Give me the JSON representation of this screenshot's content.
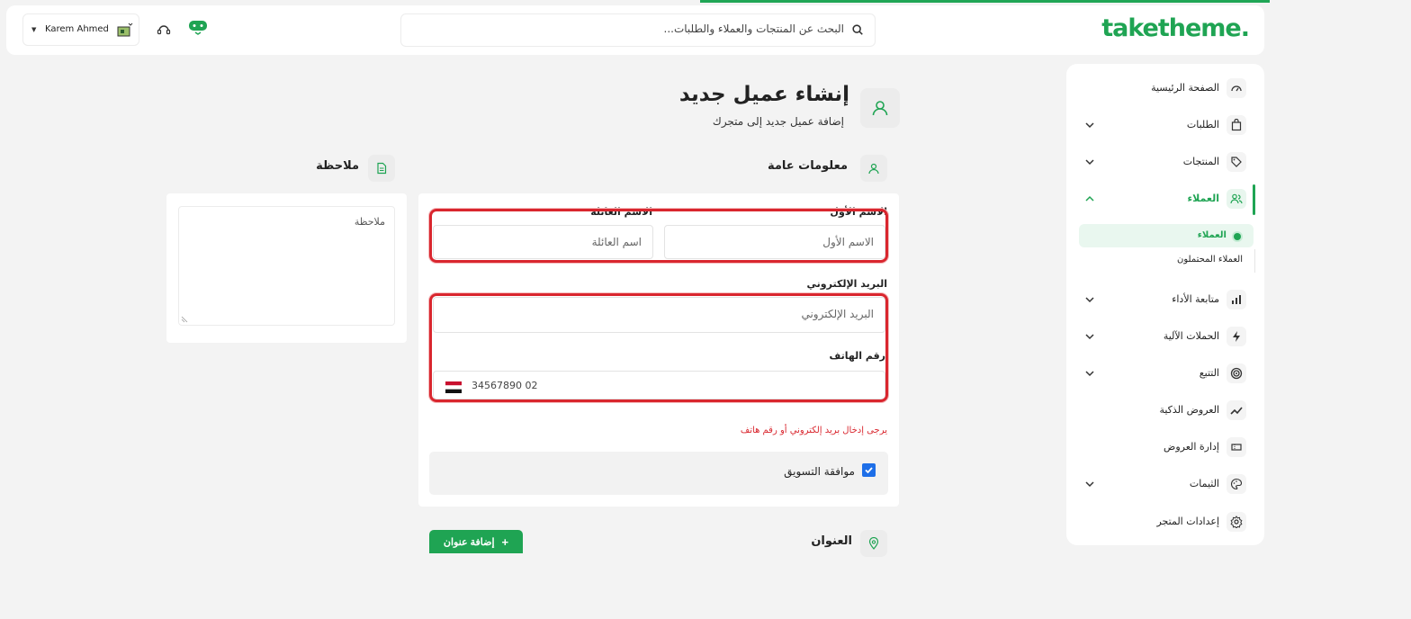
{
  "header": {
    "logo": "taketheme.",
    "search_placeholder": "البحث عن المنتجات والعملاء والطلبات...",
    "user_name": "Karem Ahmed"
  },
  "sidebar": {
    "items": [
      {
        "label": "الصفحة الرئيسية",
        "icon": "dashboard-icon"
      },
      {
        "label": "الطلبات",
        "icon": "bag-icon"
      },
      {
        "label": "المنتجات",
        "icon": "tag-icon"
      },
      {
        "label": "العملاء",
        "icon": "users-icon"
      },
      {
        "label": "متابعة الأداء",
        "icon": "bar-chart-icon"
      },
      {
        "label": "الحملات الآلية",
        "icon": "bolt-icon"
      },
      {
        "label": "التتبع",
        "icon": "target-icon"
      },
      {
        "label": "العروض الذكية",
        "icon": "trend-icon"
      },
      {
        "label": "إدارة العروض",
        "icon": "ticket-icon"
      },
      {
        "label": "الثيمات",
        "icon": "palette-icon"
      },
      {
        "label": "إعدادات المتجر",
        "icon": "settings-icon"
      }
    ],
    "sub_items": [
      "العملاء",
      "العملاء المحتملون"
    ]
  },
  "page": {
    "title": "إنشاء عميل جديد",
    "subtitle": "إضافة عميل جديد إلى متجرك"
  },
  "general": {
    "title": "معلومات عامة",
    "first_name_label": "الاسم الأول",
    "first_name_placeholder": "الاسم الأول",
    "last_name_label": "الاسم العائلة",
    "last_name_placeholder": "اسم العائلة",
    "email_label": "البريد الإلكتروني",
    "email_placeholder": "البريد الإلكتروني",
    "phone_label": "رقم الهاتف",
    "phone_placeholder": "02 34567890",
    "error": "يرجى إدخال بريد إلكتروني أو رقم هاتف",
    "consent_label": "موافقة التسويق"
  },
  "note": {
    "title": "ملاحظة",
    "placeholder": "ملاحظة"
  },
  "address": {
    "title": "العنوان",
    "add_button": "إضافة عنوان"
  }
}
